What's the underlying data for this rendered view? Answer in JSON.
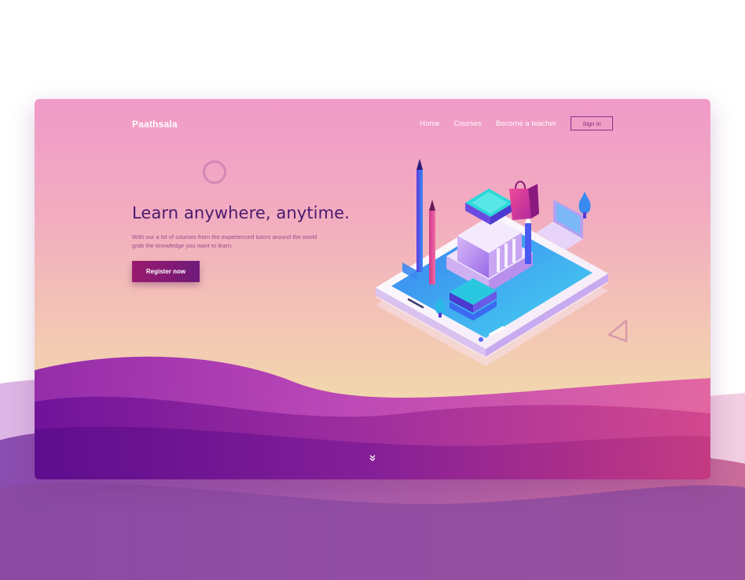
{
  "nav": {
    "brand": "Paathsala",
    "links": [
      {
        "label": "Home"
      },
      {
        "label": "Courses"
      },
      {
        "label": "Become a teacher"
      }
    ],
    "signin_label": "Sign In"
  },
  "hero": {
    "title": "Learn anywhere, anytime.",
    "subtitle": "With our a lot of courses from the experienced tutors around the world grab the knowledge you want to learn.",
    "cta_label": "Register now"
  },
  "icons": {
    "scroll": "double-chevron-down-icon",
    "deco_circle": "circle-outline-icon",
    "deco_triangle": "triangle-outline-icon",
    "illustration": "isometric-phone-school-illustration"
  },
  "colors": {
    "card_top": "#f09ac8",
    "card_bottom": "#f1e3a8",
    "title": "#4a1a6e",
    "cta_start": "#9a1a6e",
    "cta_end": "#6e1a7a",
    "wave_purple": "#7a1aa0",
    "wave_magenta": "#c8388a"
  }
}
